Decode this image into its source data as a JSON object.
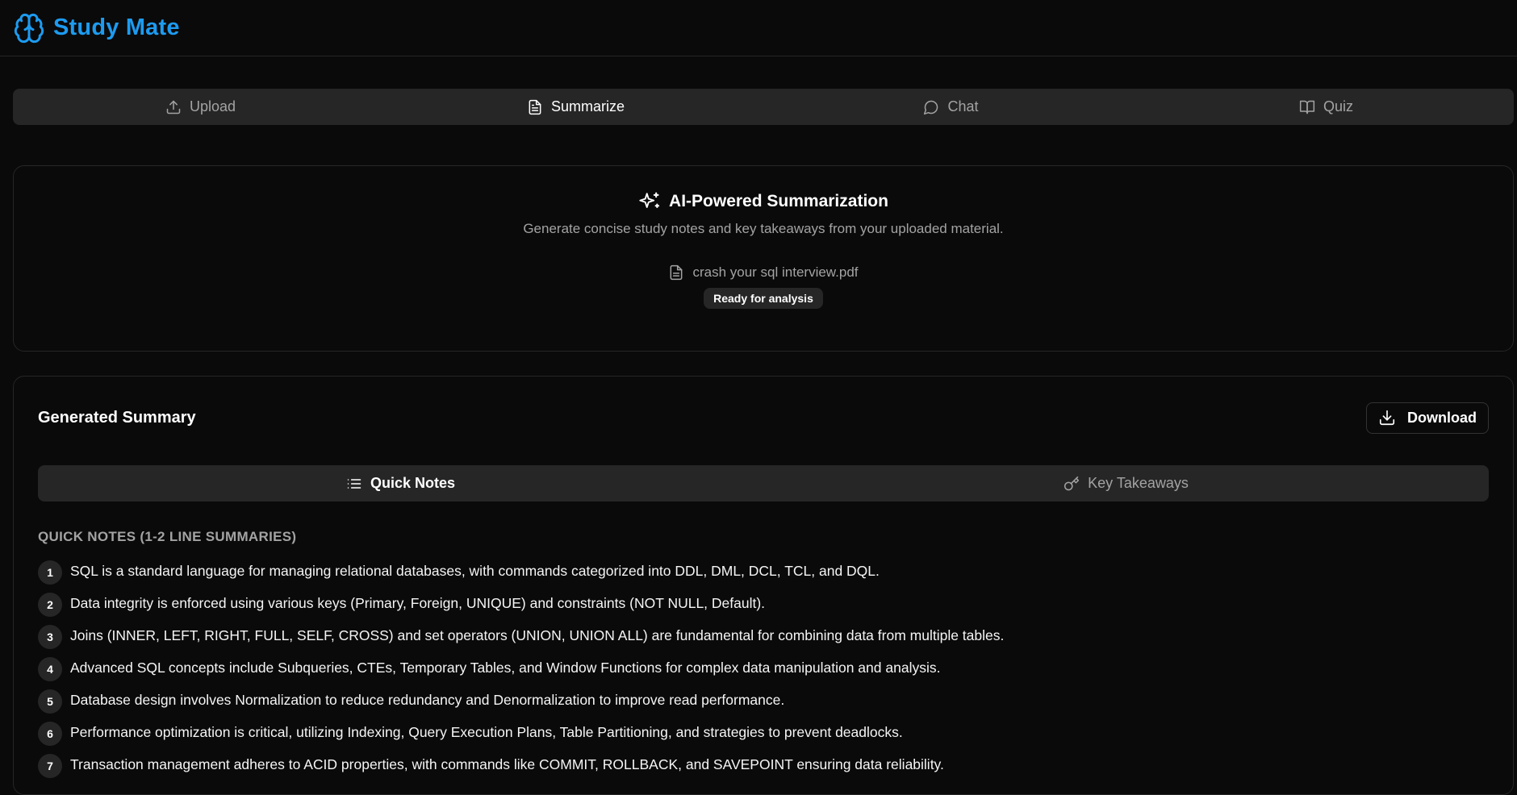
{
  "app": {
    "brand": "Study Mate",
    "accent": "#1d9bf0"
  },
  "tabs": [
    {
      "label": "Upload",
      "icon": "upload-icon",
      "active": false
    },
    {
      "label": "Summarize",
      "icon": "file-text-icon",
      "active": true
    },
    {
      "label": "Chat",
      "icon": "chat-bubble-icon",
      "active": false
    },
    {
      "label": "Quiz",
      "icon": "book-open-icon",
      "active": false
    }
  ],
  "summarize": {
    "title": "AI-Powered Summarization",
    "subtitle": "Generate concise study notes and key takeaways from your uploaded material.",
    "file_name": "crash your sql interview.pdf",
    "status": "Ready for analysis"
  },
  "summary": {
    "title": "Generated Summary",
    "download_label": "Download",
    "subtabs": [
      {
        "label": "Quick Notes",
        "icon": "list-icon",
        "active": true
      },
      {
        "label": "Key Takeaways",
        "icon": "key-icon",
        "active": false
      }
    ],
    "section_label": "QUICK NOTES (1-2 LINE SUMMARIES)",
    "notes": [
      {
        "num": "1",
        "text": "SQL is a standard language for managing relational databases, with commands categorized into DDL, DML, DCL, TCL, and DQL."
      },
      {
        "num": "2",
        "text": "Data integrity is enforced using various keys (Primary, Foreign, UNIQUE) and constraints (NOT NULL, Default)."
      },
      {
        "num": "3",
        "text": "Joins (INNER, LEFT, RIGHT, FULL, SELF, CROSS) and set operators (UNION, UNION ALL) are fundamental for combining data from multiple tables."
      },
      {
        "num": "4",
        "text": "Advanced SQL concepts include Subqueries, CTEs, Temporary Tables, and Window Functions for complex data manipulation and analysis."
      },
      {
        "num": "5",
        "text": "Database design involves Normalization to reduce redundancy and Denormalization to improve read performance."
      },
      {
        "num": "6",
        "text": "Performance optimization is critical, utilizing Indexing, Query Execution Plans, Table Partitioning, and strategies to prevent deadlocks."
      },
      {
        "num": "7",
        "text": "Transaction management adheres to ACID properties, with commands like COMMIT, ROLLBACK, and SAVEPOINT ensuring data reliability."
      }
    ]
  }
}
